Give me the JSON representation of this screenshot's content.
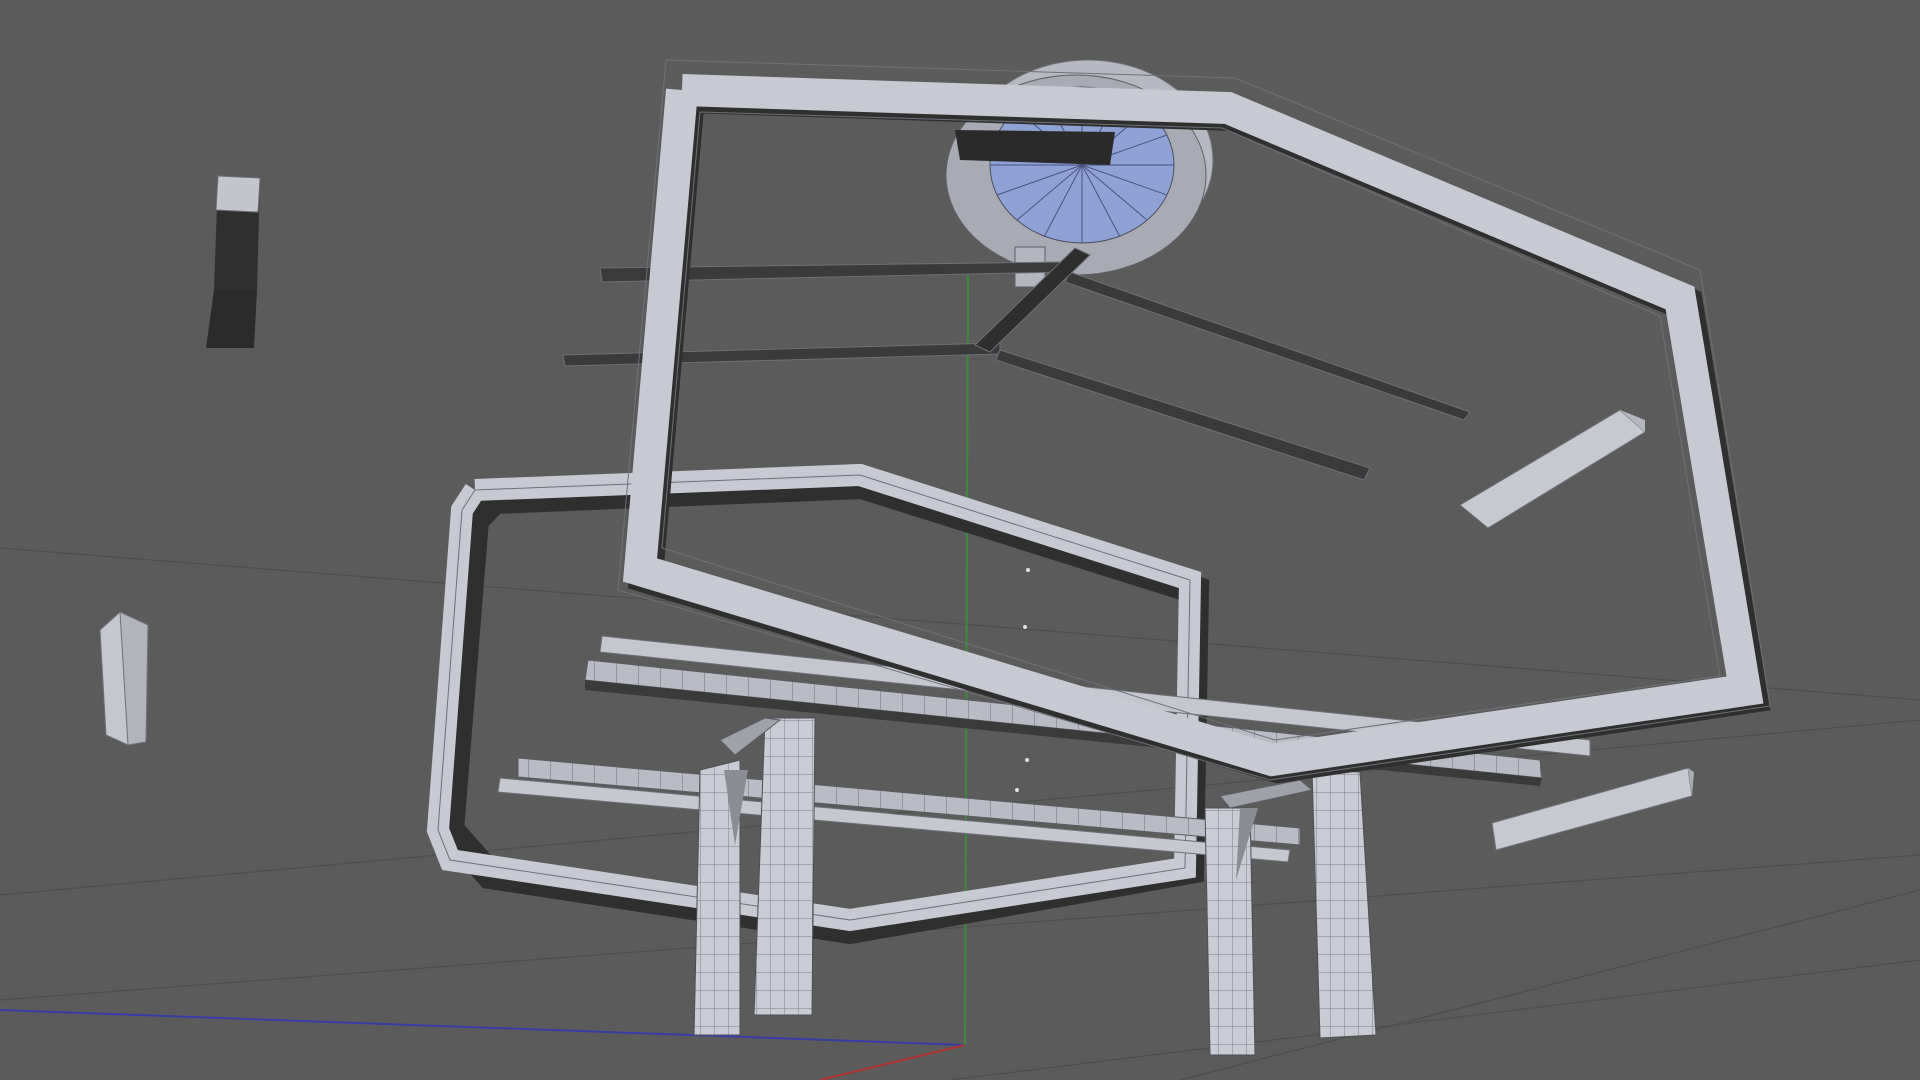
{
  "viewport": {
    "projection": "perspective",
    "background_color": "#5b5b5b",
    "grid": true,
    "grid_color": "#4e4e4e",
    "axes": {
      "x_color": "#b03030",
      "y_color": "#3c8a3c",
      "z_color": "#3a3aa8"
    },
    "shading": "solid-wireframe",
    "mesh_face_color": "#c7cad3",
    "mesh_shadow_color": "#2e2e2e",
    "mesh_edge_color": "#6e7079",
    "cylinder_cap_color": "#8ea2d6"
  },
  "scene": {
    "objects": [
      "hexagonal-frame-upper",
      "hexagonal-frame-lower",
      "cylinder-disc",
      "rail-beams",
      "support-columns",
      "floating-blocks"
    ]
  }
}
